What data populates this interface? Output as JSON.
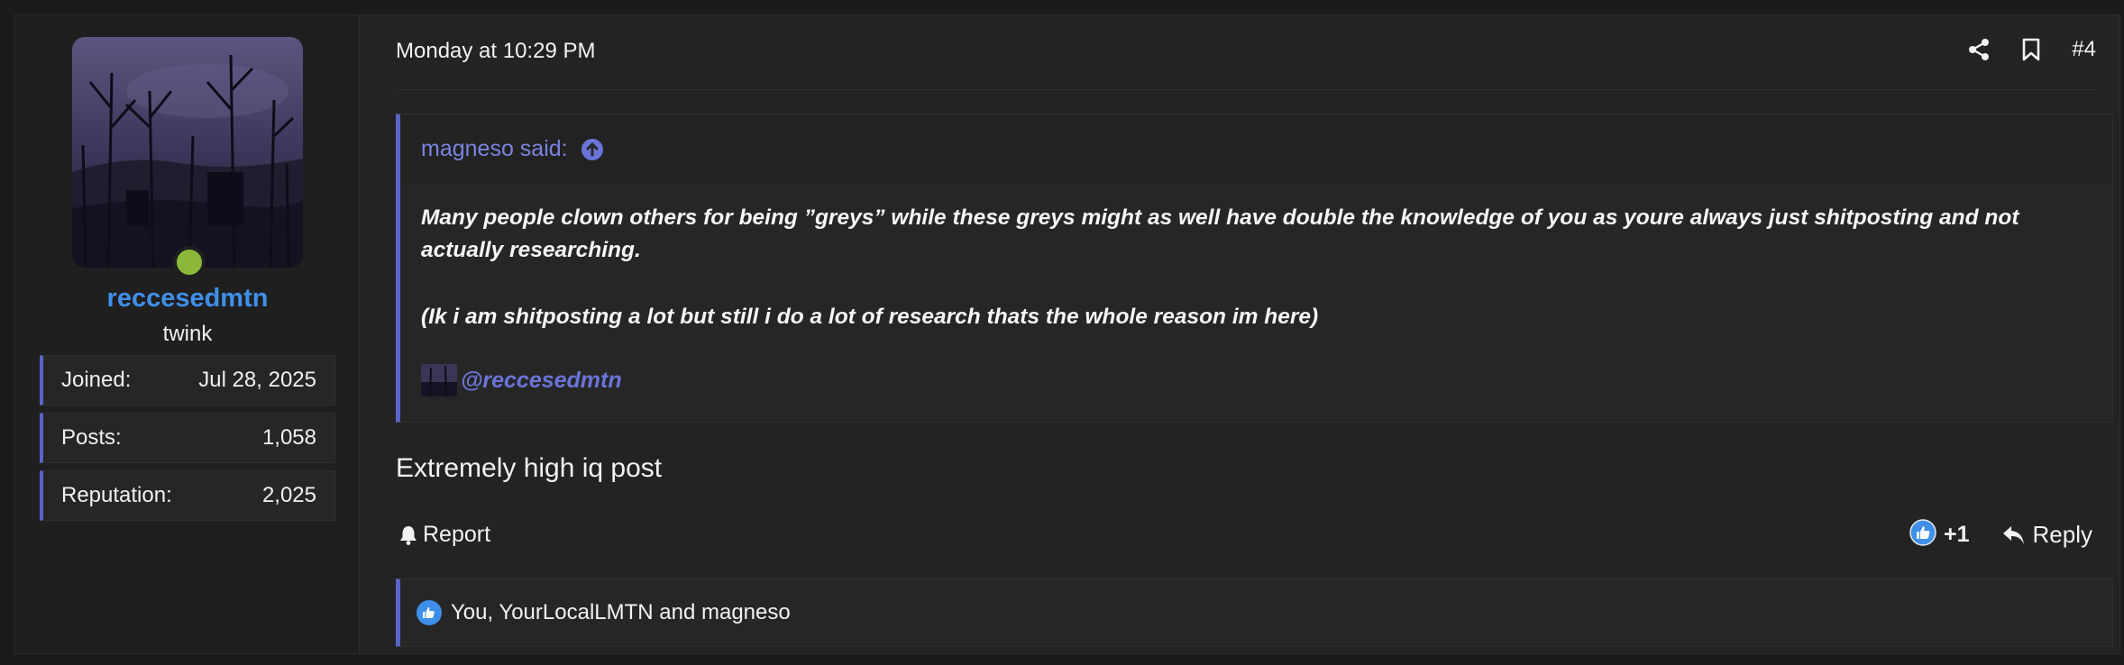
{
  "user": {
    "username": "reccesedmtn",
    "title": "twink",
    "status": "online",
    "stats": [
      {
        "label": "Joined:",
        "value": "Jul 28, 2025"
      },
      {
        "label": "Posts:",
        "value": "1,058"
      },
      {
        "label": "Reputation:",
        "value": "2,025"
      }
    ]
  },
  "post": {
    "date": "Monday at 10:29 PM",
    "number": "#4",
    "icons": [
      "share-icon",
      "bookmark-icon"
    ],
    "quote": {
      "author_label": "magneso said:",
      "paragraphs": [
        "Many people clown others for being ”greys” while these greys might as well have double the knowledge of you as youre always just shitposting and not actually researching.",
        "(Ik i am shitposting a lot but still i do a lot of research thats the whole reason im here)"
      ],
      "mention": "@reccesedmtn"
    },
    "message": "Extremely high iq post",
    "actions": {
      "report": "Report",
      "reaction_count": "+1",
      "reply": "Reply"
    },
    "reactions_summary": "You, YourLocalLMTN and magneso"
  },
  "colors": {
    "accent": "#5a64c8",
    "username": "#3f8fea",
    "online": "#8cb83a",
    "quote_author": "#7a84e0"
  }
}
